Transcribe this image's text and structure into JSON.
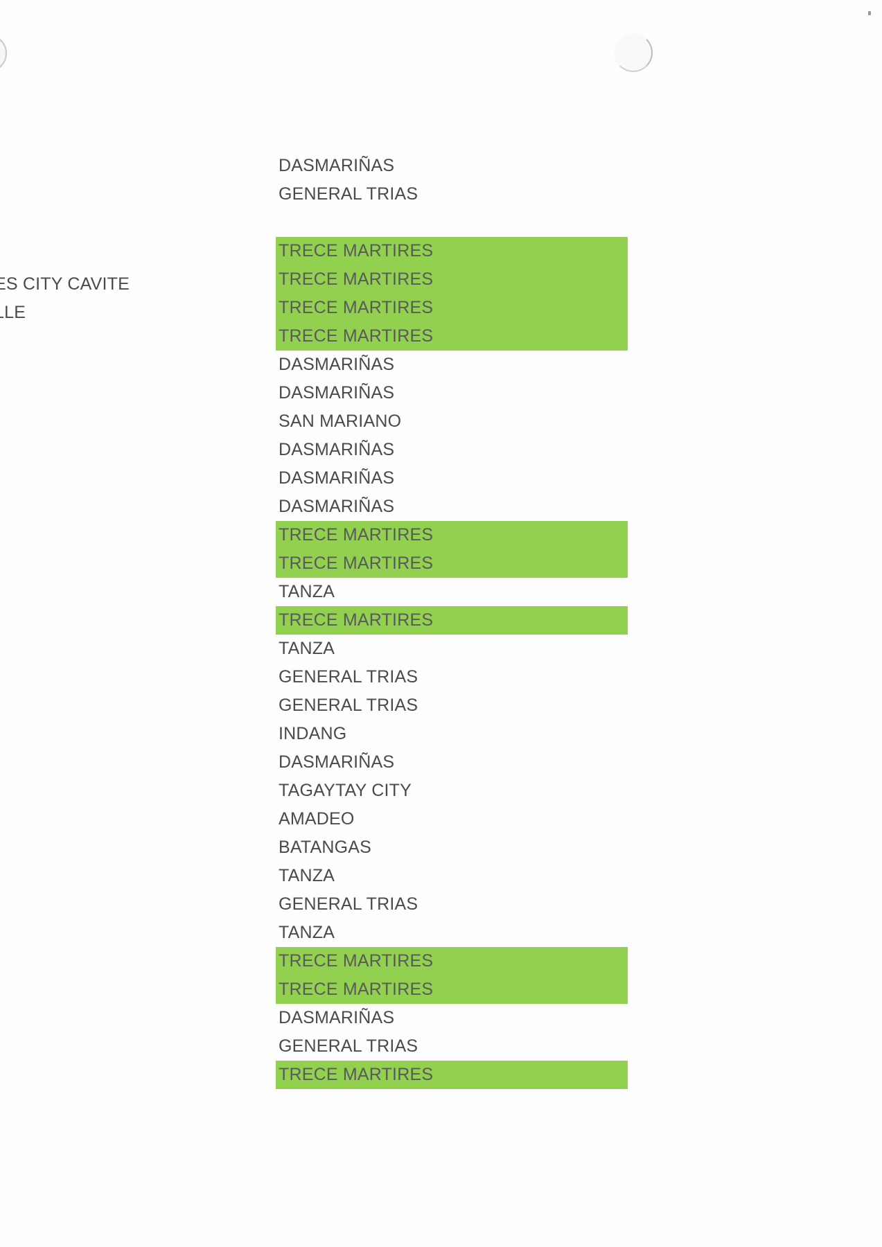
{
  "page": {
    "highlight_color": "#92d050",
    "text_color": "#4a4a4a"
  },
  "left_column": {
    "lines": [
      "ES CITY CAVITE",
      "LLE"
    ]
  },
  "city_list": {
    "rows": [
      {
        "text": "DASMARIÑAS",
        "highlighted": false
      },
      {
        "text": "GENERAL TRIAS",
        "highlighted": false
      },
      {
        "text": "",
        "highlighted": false
      },
      {
        "text": "TRECE MARTIRES",
        "highlighted": true
      },
      {
        "text": "TRECE MARTIRES",
        "highlighted": true
      },
      {
        "text": "TRECE MARTIRES",
        "highlighted": true
      },
      {
        "text": "TRECE MARTIRES",
        "highlighted": true
      },
      {
        "text": "DASMARIÑAS",
        "highlighted": false
      },
      {
        "text": "DASMARIÑAS",
        "highlighted": false
      },
      {
        "text": "SAN MARIANO",
        "highlighted": false
      },
      {
        "text": "DASMARIÑAS",
        "highlighted": false
      },
      {
        "text": "DASMARIÑAS",
        "highlighted": false
      },
      {
        "text": "DASMARIÑAS",
        "highlighted": false
      },
      {
        "text": "TRECE MARTIRES",
        "highlighted": true
      },
      {
        "text": "TRECE MARTIRES",
        "highlighted": true
      },
      {
        "text": "TANZA",
        "highlighted": false
      },
      {
        "text": "TRECE MARTIRES",
        "highlighted": true
      },
      {
        "text": "TANZA",
        "highlighted": false
      },
      {
        "text": "GENERAL TRIAS",
        "highlighted": false
      },
      {
        "text": "GENERAL TRIAS",
        "highlighted": false
      },
      {
        "text": "INDANG",
        "highlighted": false
      },
      {
        "text": "DASMARIÑAS",
        "highlighted": false
      },
      {
        "text": "TAGAYTAY CITY",
        "highlighted": false
      },
      {
        "text": "AMADEO",
        "highlighted": false
      },
      {
        "text": "BATANGAS",
        "highlighted": false
      },
      {
        "text": "TANZA",
        "highlighted": false
      },
      {
        "text": "GENERAL TRIAS",
        "highlighted": false
      },
      {
        "text": "TANZA",
        "highlighted": false
      },
      {
        "text": "TRECE MARTIRES",
        "highlighted": true
      },
      {
        "text": "TRECE MARTIRES",
        "highlighted": true
      },
      {
        "text": "DASMARIÑAS",
        "highlighted": false
      },
      {
        "text": "GENERAL TRIAS",
        "highlighted": false
      },
      {
        "text": "TRECE MARTIRES",
        "highlighted": true
      }
    ]
  }
}
